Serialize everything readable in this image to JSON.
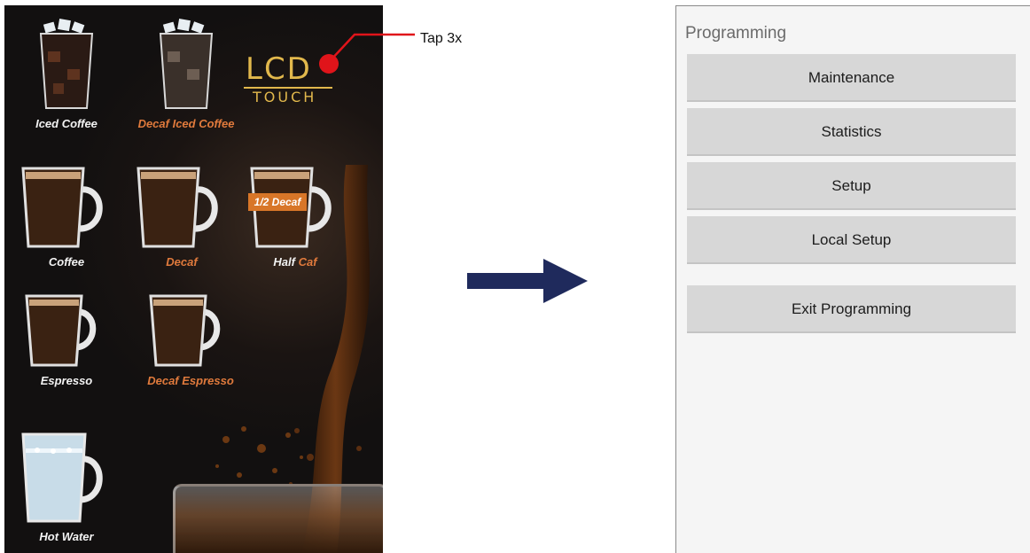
{
  "machine": {
    "logo": {
      "top": "LCD",
      "bottom": "TOUCH"
    },
    "annotation": "Tap 3x",
    "drinks": [
      {
        "id": "iced-coffee",
        "label": "Iced Coffee",
        "style": "white"
      },
      {
        "id": "decaf-iced-coffee",
        "label": "Decaf Iced Coffee",
        "style": "orange"
      },
      {
        "id": "coffee",
        "label": "Coffee",
        "style": "white"
      },
      {
        "id": "decaf",
        "label": "Decaf",
        "style": "orange"
      },
      {
        "id": "half-caf",
        "label_part1": "Half",
        "label_part2": "Caf",
        "badge": "1/2 Decaf"
      },
      {
        "id": "espresso",
        "label": "Espresso",
        "style": "white"
      },
      {
        "id": "decaf-espresso",
        "label": "Decaf Espresso",
        "style": "orange"
      },
      {
        "id": "hot-water",
        "label": "Hot Water",
        "style": "white"
      }
    ]
  },
  "arrow": {
    "color": "#1f2a5c"
  },
  "programming": {
    "title": "Programming",
    "buttons": [
      "Maintenance",
      "Statistics",
      "Setup",
      "Local Setup",
      "Exit Programming"
    ]
  },
  "colors": {
    "accent_orange": "#e07a3c",
    "tap_red": "#e0141a",
    "logo_gold": "#e2b84c",
    "button_gray": "#d7d7d7"
  }
}
